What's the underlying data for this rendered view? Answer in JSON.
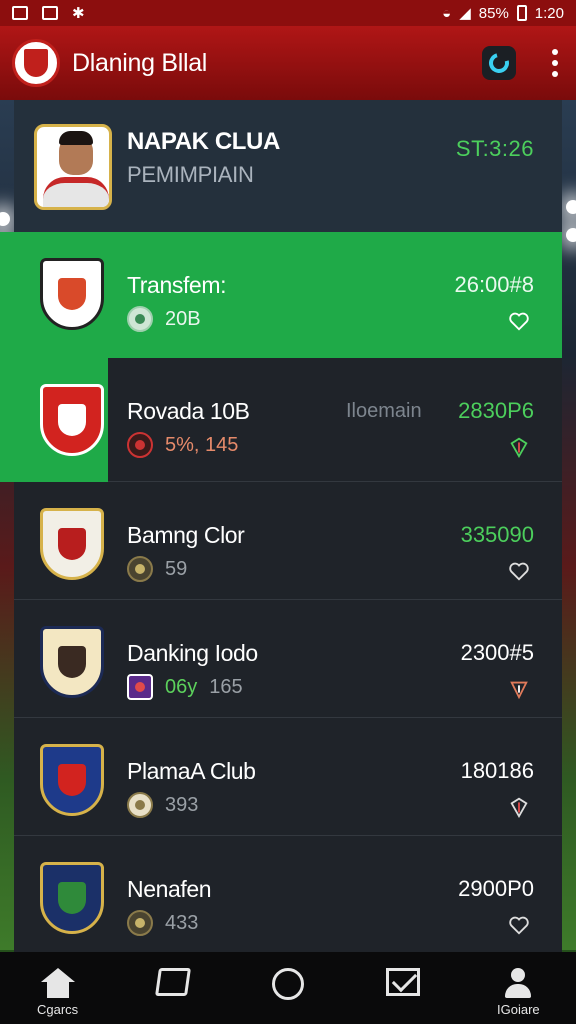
{
  "status_bar": {
    "battery": "85%",
    "time": "1:20"
  },
  "app_bar": {
    "title": "Dlaning Bllal",
    "icons": [
      "club-crest-icon",
      "refresh-icon",
      "more-vertical-icon"
    ]
  },
  "header_card": {
    "name": "NAPAK CLUA",
    "subtitle": "PEMIMPIAIN",
    "time": "ST:3:26",
    "time_color": "#4ccf5c"
  },
  "list": [
    {
      "name": "Transfem:",
      "sub_value": "20B",
      "sub_highlight": "",
      "sub_rest": "",
      "value": "26:00#8",
      "value_color": "#e9f9ee",
      "heart": "heart-outline-icon",
      "active": true
    },
    {
      "name": "Rovada 10B",
      "middle": "Ilоemain",
      "sub_value": "5%, 145",
      "value": "2830P6",
      "value_color": "#4ccf5c",
      "heart": "heart-shield-icon"
    },
    {
      "name": "Bamng Clor",
      "sub_value": "59",
      "value": "335090",
      "value_color": "#4ccf5c",
      "heart": "heart-outline-icon"
    },
    {
      "name": "Danking Iodo",
      "sub_highlight": "06y",
      "sub_rest": "165",
      "value": "2300#5",
      "value_color": "#ffffff",
      "heart": "heart-shield-icon"
    },
    {
      "name": "PlamaA Club",
      "sub_value": "393",
      "value": "180186",
      "value_color": "#ffffff",
      "heart": "heart-shield-icon"
    },
    {
      "name": "Nenafen",
      "sub_value": "433",
      "value": "2900P0",
      "value_color": "#ffffff",
      "heart": "heart-outline-icon"
    }
  ],
  "bottom_nav": [
    {
      "label": "Cgarcs",
      "icon": "home-icon"
    },
    {
      "label": "",
      "icon": "book-icon"
    },
    {
      "label": "",
      "icon": "circle-icon"
    },
    {
      "label": "",
      "icon": "mail-icon"
    },
    {
      "label": "IGoiare",
      "icon": "profile-icon"
    }
  ],
  "colors": {
    "accent_green": "#1faa48",
    "brand_red": "#a01212",
    "panel": "#1f2329"
  }
}
